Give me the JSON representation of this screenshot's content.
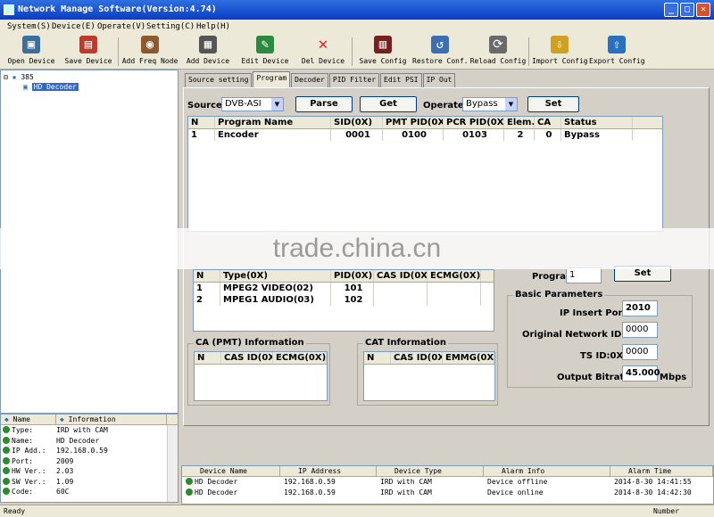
{
  "window": {
    "title": "Network Manage Software(Version:4.74)"
  },
  "menu": [
    "System(S)",
    "Device(E)",
    "Operate(V)",
    "Setting(C)",
    "Help(H)"
  ],
  "toolbar": [
    {
      "label": "Open Device",
      "icon": "open-device-icon",
      "color": "#3a6f9e"
    },
    {
      "label": "Save Device",
      "icon": "save-device-icon",
      "color": "#c0392b"
    },
    {
      "label": "Add Freq Node",
      "icon": "add-freq-node-icon",
      "color": "#8e5a2b"
    },
    {
      "label": "Add Device",
      "icon": "add-device-icon",
      "color": "#555555"
    },
    {
      "label": "Edit Device",
      "icon": "edit-device-icon",
      "color": "#2b8a3e"
    },
    {
      "label": "Del Device",
      "icon": "delete-device-icon",
      "color": "#e02020"
    },
    {
      "label": "Save Config",
      "icon": "save-config-icon",
      "color": "#7a1f1f"
    },
    {
      "label": "Restore Conf.",
      "icon": "restore-config-icon",
      "color": "#3d6fb0"
    },
    {
      "label": "Reload Config",
      "icon": "reload-config-icon",
      "color": "#6a6a6a"
    },
    {
      "label": "Import Config",
      "icon": "import-config-icon",
      "color": "#d0a020"
    },
    {
      "label": "Export Config",
      "icon": "export-config-icon",
      "color": "#2a70c0"
    }
  ],
  "tree": {
    "root": "385",
    "child": "HD Decoder"
  },
  "properties": {
    "headers": [
      "Name",
      "Information"
    ],
    "rows": [
      {
        "key": "Type:",
        "value": "IRD with CAM"
      },
      {
        "key": "Name:",
        "value": "HD Decoder"
      },
      {
        "key": "IP Add.:",
        "value": "192.168.0.59"
      },
      {
        "key": "Port:",
        "value": "2009"
      },
      {
        "key": "HW Ver.:",
        "value": "2.03"
      },
      {
        "key": "SW Ver.:",
        "value": "1.09"
      },
      {
        "key": "Code:",
        "value": "60C"
      }
    ]
  },
  "tabs": [
    "Source setting",
    "Program",
    "Decoder",
    "PID Filter",
    "Edit PSI",
    "IP Out"
  ],
  "source": {
    "label": "Source:",
    "value": "DVB-ASI"
  },
  "operate": {
    "label": "Operate:",
    "value": "Bypass"
  },
  "buttons": {
    "parse": "Parse",
    "get": "Get",
    "set": "Set",
    "program_set": "Set"
  },
  "program_table": {
    "headers": [
      "N",
      "Program Name",
      "SID(0X)",
      "PMT PID(0X)",
      "PCR PID(0X)",
      "Elem.",
      "CA",
      "Status"
    ],
    "rows": [
      [
        "1",
        "Encoder",
        "0001",
        "0100",
        "0103",
        "2",
        "0",
        "Bypass"
      ]
    ]
  },
  "elem_table": {
    "headers": [
      "N",
      "Type(0X)",
      "PID(0X)",
      "CAS ID(0X)",
      "ECMG(0X)"
    ],
    "rows": [
      [
        "1",
        "MPEG2 VIDEO(02)",
        "101",
        "",
        ""
      ],
      [
        "2",
        "MPEG1 AUDIO(03)",
        "102",
        "",
        ""
      ]
    ]
  },
  "ca_pmt": {
    "title": "CA (PMT) Information",
    "headers": [
      "N",
      "CAS ID(0X)",
      "ECMG(0X)"
    ]
  },
  "cat": {
    "title": "CAT Information",
    "headers": [
      "N",
      "CAS ID(0X)",
      "EMMG(0X)"
    ]
  },
  "program_field": {
    "label": "Program",
    "value": "1"
  },
  "basic": {
    "title": "Basic Parameters",
    "ip_insert_port": {
      "label": "IP Insert Port:",
      "value": "2010"
    },
    "onid": {
      "label": "Original Network ID:0X",
      "value": "0000"
    },
    "tsid": {
      "label": "TS ID:0X",
      "value": "0000"
    },
    "bitrate": {
      "label": "Output Bitrate:",
      "value": "45.000",
      "unit": "Mbps"
    }
  },
  "alarm": {
    "headers": [
      "Device Name",
      "IP Address",
      "Device Type",
      "Alarm Info",
      "Alarm Time"
    ],
    "rows": [
      [
        "HD Decoder",
        "192.168.0.59",
        "IRD with CAM",
        "Device offline",
        "2014-8-30 14:41:55"
      ],
      [
        "HD Decoder",
        "192.168.0.59",
        "IRD with CAM",
        "Device online",
        "2014-8-30 14:42:30"
      ]
    ]
  },
  "status": {
    "left": "Ready",
    "right": "Number"
  },
  "watermark": "trade.china.cn"
}
